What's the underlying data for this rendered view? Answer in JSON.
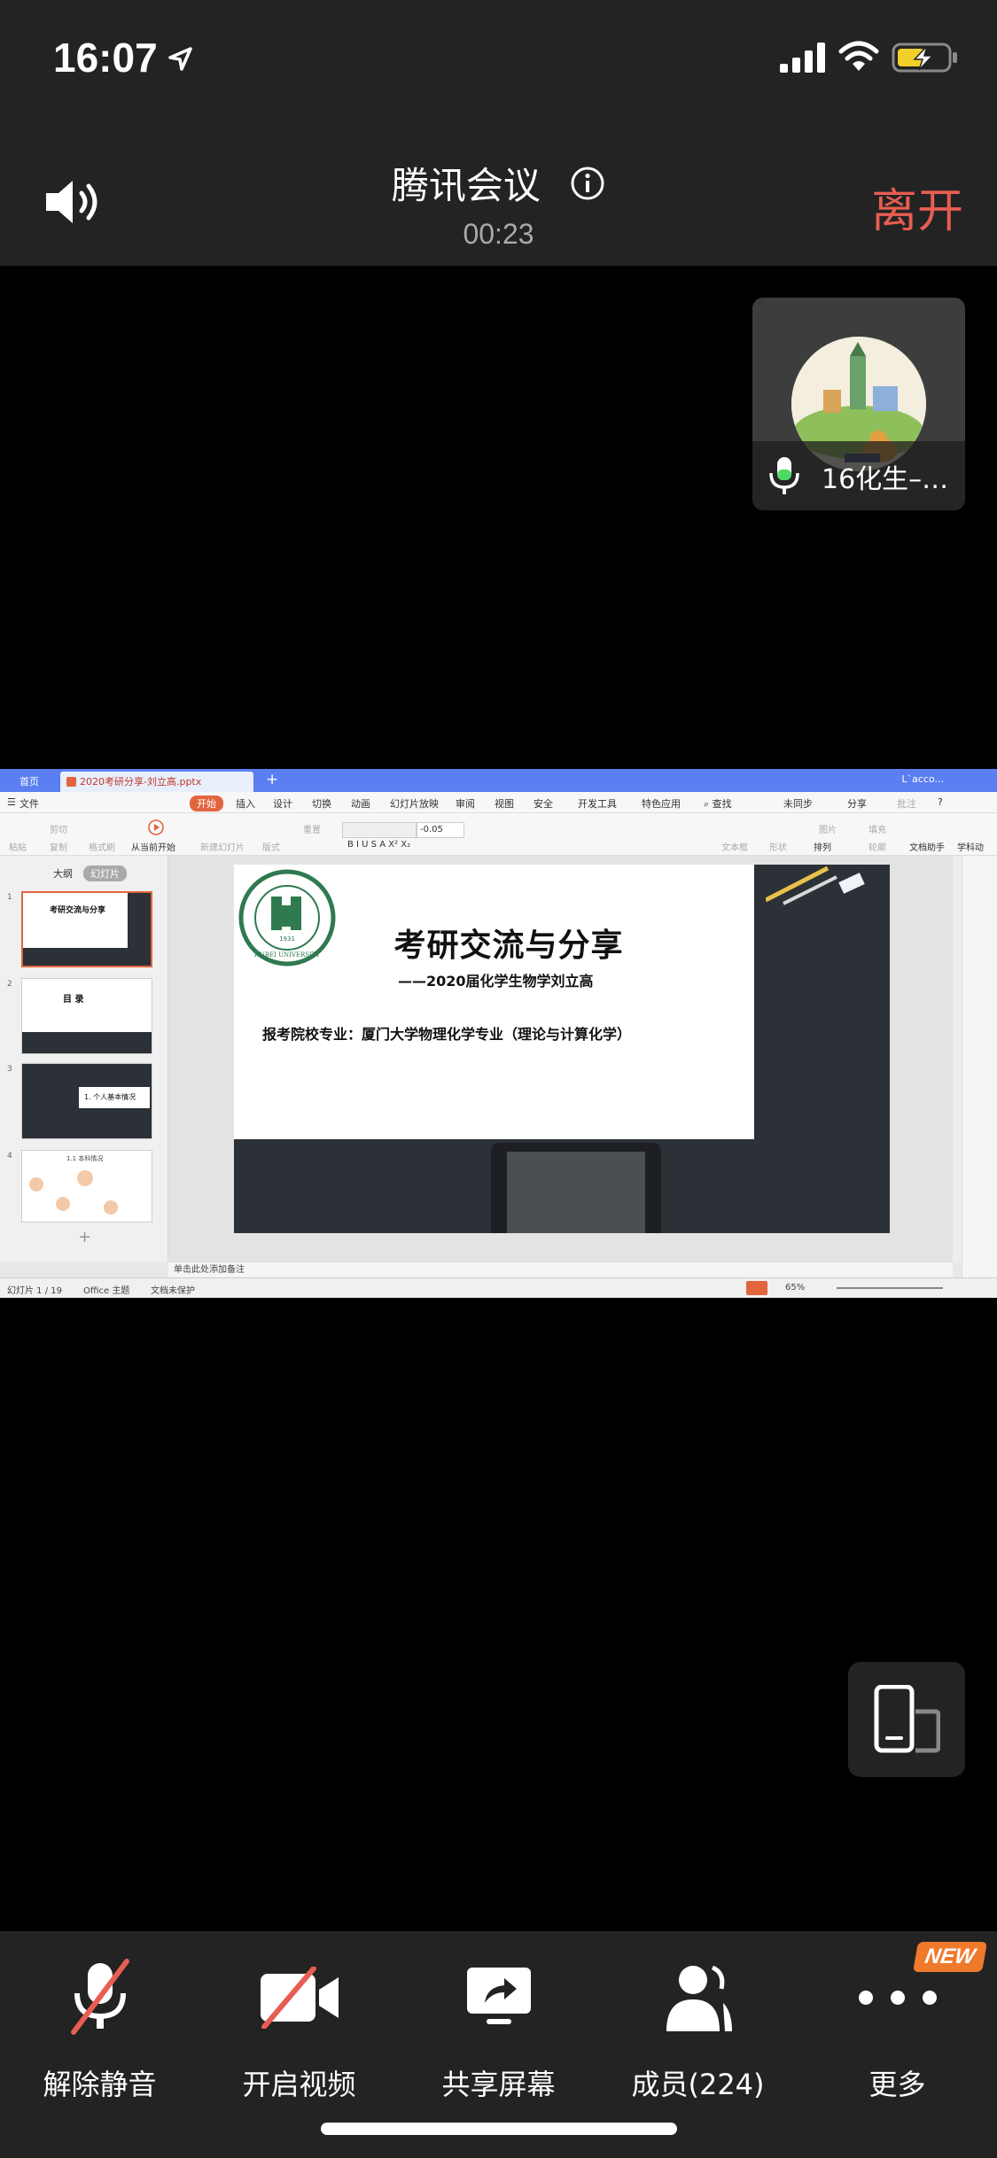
{
  "status_bar": {
    "time": "16:07"
  },
  "header": {
    "title": "腾讯会议",
    "timer": "00:23",
    "leave_label": "离开"
  },
  "participant": {
    "name": "16化生–…"
  },
  "shared_screen": {
    "tabs": {
      "home": "首页",
      "doc": "2020考研分享-刘立高.pptx",
      "account": "L`acco..."
    },
    "menu": {
      "file": "文件",
      "start": "开始",
      "insert": "插入",
      "design": "设计",
      "switch": "切换",
      "animation": "动画",
      "slideshow": "幻灯片放映",
      "review": "审阅",
      "view": "视图",
      "security": "安全",
      "devtools": "开发工具",
      "special": "特色应用",
      "search": "查找",
      "unsync": "未同步",
      "share": "分享",
      "comment": "批注",
      "help": "?"
    },
    "ribbon": {
      "paste": "粘贴",
      "cut": "剪切",
      "copy": "复制",
      "format_painter": "格式刷",
      "from_current": "从当前开始",
      "new_slide": "新建幻灯片",
      "layout": "版式",
      "reset": "重置",
      "font_size": "-0.05",
      "textbox": "文本框",
      "shape": "形状",
      "arrange": "排列",
      "picture": "图片",
      "fill": "填充",
      "outline": "轮廓",
      "doc_assistant": "文档助手",
      "subject_tools": "学科动"
    },
    "left_panel": {
      "outline_tab": "大纲",
      "slides_tab": "幻灯片",
      "slide_numbers": [
        "1",
        "2",
        "3",
        "4"
      ]
    },
    "thumbnails": {
      "t1_title": "考研交流与分享",
      "t2_title": "目 录",
      "t3_title": "1. 个人基本情况",
      "t4_title": "1.1 本科情况"
    },
    "slide": {
      "logo_year": "1931",
      "logo_text": "HUBEI UNIVERSITY",
      "title": "考研交流与分享",
      "subtitle": "——2020届化学生物学刘立高",
      "body": "报考院校专业：厦门大学物理化学专业（理论与计算化学）"
    },
    "notes_placeholder": "单击此处添加备注",
    "status": {
      "slide_counter": "幻灯片 1 / 19",
      "theme": "Office 主题",
      "protection": "文档未保护",
      "zoom": "65%"
    }
  },
  "toolbar": {
    "unmute": "解除静音",
    "start_video": "开启视频",
    "share_screen": "共享屏幕",
    "members": "成员(224)",
    "more": "更多",
    "new_badge": "NEW"
  },
  "colors": {
    "accent_leave": "#e85d52",
    "new_badge": "#f07a2c",
    "wps_blue": "#5b7ff2",
    "wps_orange": "#e2653e"
  }
}
